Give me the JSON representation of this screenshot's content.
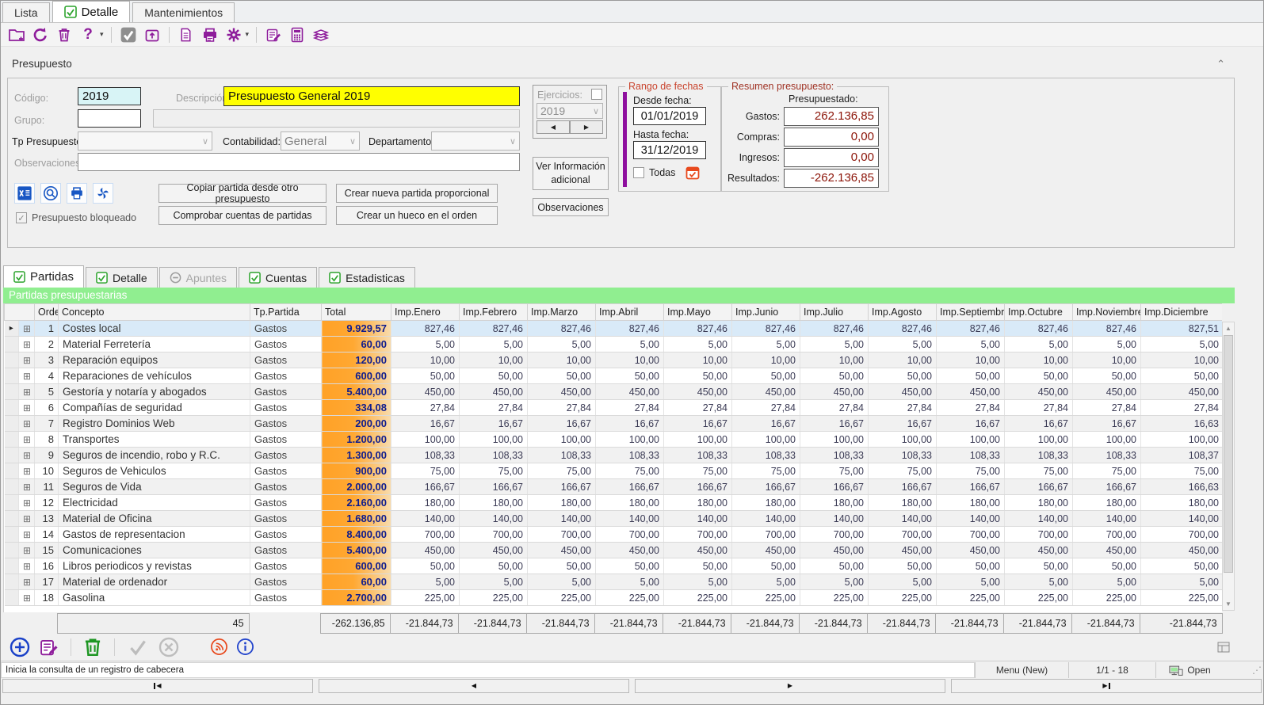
{
  "main_tabs": {
    "lista": "Lista",
    "detalle": "Detalle",
    "mantenimientos": "Mantenimientos"
  },
  "top_toolbar_icons": [
    "new-record-icon",
    "undo-icon",
    "delete-icon",
    "help-icon",
    "help-dropdown-icon",
    "confirm-checkbox-icon",
    "open-window-icon",
    "document-icon",
    "print-icon",
    "settings-gear-icon",
    "settings-dropdown-icon",
    "edit-notes-icon",
    "calculator-icon",
    "books-icon"
  ],
  "form": {
    "section_title": "Presupuesto",
    "codigo": {
      "label": "Código:",
      "value": "2019"
    },
    "descripcion": {
      "label": "Descripción:",
      "value": "Presupuesto General 2019"
    },
    "grupo": {
      "label": "Grupo:",
      "value": ""
    },
    "tp_presupuesto": {
      "label": "Tp Presupuesto:",
      "value": ""
    },
    "contabilidad": {
      "label": "Contabilidad:",
      "value": "General"
    },
    "departamento": {
      "label": "Departamento:",
      "value": ""
    },
    "observaciones": {
      "label": "Observaciones:",
      "value": ""
    },
    "mini_icons": [
      "excel-icon",
      "preview-icon",
      "print-icon",
      "refresh-icon"
    ],
    "bloqueado_label": "Presupuesto bloqueado",
    "action_buttons": [
      "Copiar partida desde otro presupuesto",
      "Crear nueva partida proporcional",
      "Comprobar cuentas de partidas",
      "Crear un hueco en el orden"
    ]
  },
  "ejercicios": {
    "label": "Ejercicios:",
    "value": "2019"
  },
  "side_buttons": {
    "ver_info": "Ver Información adicional",
    "observaciones": "Observaciones"
  },
  "rango_fechas": {
    "title": "Rango de fechas",
    "desde_label": "Desde fecha:",
    "desde_value": "01/01/2019",
    "hasta_label": "Hasta fecha:",
    "hasta_value": "31/12/2019",
    "todas_label": "Todas",
    "calendar_icon": "calendar-icon"
  },
  "resumen": {
    "title": "Resumen presupuesto:",
    "header": "Presupuestado:",
    "rows": [
      {
        "label": "Gastos:",
        "value": "262.136,85"
      },
      {
        "label": "Compras:",
        "value": "0,00"
      },
      {
        "label": "Ingresos:",
        "value": "0,00"
      },
      {
        "label": "Resultados:",
        "value": "-262.136,85"
      }
    ]
  },
  "subtabs": [
    {
      "label": "Partidas",
      "state": "active"
    },
    {
      "label": "Detalle",
      "state": "normal"
    },
    {
      "label": "Apuntes",
      "state": "disabled"
    },
    {
      "label": "Cuentas",
      "state": "normal"
    },
    {
      "label": "Estadisticas",
      "state": "normal"
    }
  ],
  "grid": {
    "title": "Partidas presupuestarias",
    "columns": [
      "Orden",
      "Concepto",
      "Tp.Partida",
      "Total",
      "Imp.Enero",
      "Imp.Febrero",
      "Imp.Marzo",
      "Imp.Abril",
      "Imp.Mayo",
      "Imp.Junio",
      "Imp.Julio",
      "Imp.Agosto",
      "Imp.Septiembre",
      "Imp.Octubre",
      "Imp.Noviembre",
      "Imp.Diciembre"
    ],
    "rows": [
      {
        "orden": "1",
        "concepto": "Costes local",
        "tp": "Gastos",
        "total": "9.929,57",
        "monthly": "827,46",
        "diciembre": "827,51",
        "selected": true
      },
      {
        "orden": "2",
        "concepto": "Material Ferretería",
        "tp": "Gastos",
        "total": "60,00",
        "monthly": "5,00",
        "diciembre": "5,00"
      },
      {
        "orden": "3",
        "concepto": "Reparación equipos",
        "tp": "Gastos",
        "total": "120,00",
        "monthly": "10,00",
        "diciembre": "10,00"
      },
      {
        "orden": "4",
        "concepto": "Reparaciones de vehículos",
        "tp": "Gastos",
        "total": "600,00",
        "monthly": "50,00",
        "diciembre": "50,00"
      },
      {
        "orden": "5",
        "concepto": "Gestoría y notaría y abogados",
        "tp": "Gastos",
        "total": "5.400,00",
        "monthly": "450,00",
        "diciembre": "450,00"
      },
      {
        "orden": "6",
        "concepto": "Compañías de seguridad",
        "tp": "Gastos",
        "total": "334,08",
        "monthly": "27,84",
        "diciembre": "27,84"
      },
      {
        "orden": "7",
        "concepto": "Registro Dominios Web",
        "tp": "Gastos",
        "total": "200,00",
        "monthly": "16,67",
        "diciembre": "16,63"
      },
      {
        "orden": "8",
        "concepto": "Transportes",
        "tp": "Gastos",
        "total": "1.200,00",
        "monthly": "100,00",
        "diciembre": "100,00"
      },
      {
        "orden": "9",
        "concepto": "Seguros de incendio, robo y R.C.",
        "tp": "Gastos",
        "total": "1.300,00",
        "monthly": "108,33",
        "diciembre": "108,37"
      },
      {
        "orden": "10",
        "concepto": "Seguros de Vehiculos",
        "tp": "Gastos",
        "total": "900,00",
        "monthly": "75,00",
        "diciembre": "75,00"
      },
      {
        "orden": "11",
        "concepto": "Seguros de Vida",
        "tp": "Gastos",
        "total": "2.000,00",
        "monthly": "166,67",
        "diciembre": "166,63"
      },
      {
        "orden": "12",
        "concepto": "Electricidad",
        "tp": "Gastos",
        "total": "2.160,00",
        "monthly": "180,00",
        "diciembre": "180,00"
      },
      {
        "orden": "13",
        "concepto": "Material de Oficina",
        "tp": "Gastos",
        "total": "1.680,00",
        "monthly": "140,00",
        "diciembre": "140,00"
      },
      {
        "orden": "14",
        "concepto": "Gastos de representacion",
        "tp": "Gastos",
        "total": "8.400,00",
        "monthly": "700,00",
        "diciembre": "700,00"
      },
      {
        "orden": "15",
        "concepto": "Comunicaciones",
        "tp": "Gastos",
        "total": "5.400,00",
        "monthly": "450,00",
        "diciembre": "450,00"
      },
      {
        "orden": "16",
        "concepto": "Libros periodicos y revistas",
        "tp": "Gastos",
        "total": "600,00",
        "monthly": "50,00",
        "diciembre": "50,00"
      },
      {
        "orden": "17",
        "concepto": "Material de ordenador",
        "tp": "Gastos",
        "total": "60,00",
        "monthly": "5,00",
        "diciembre": "5,00"
      },
      {
        "orden": "18",
        "concepto": "Gasolina",
        "tp": "Gastos",
        "total": "2.700,00",
        "monthly": "225,00",
        "diciembre": "225,00"
      }
    ],
    "footer": {
      "count": "45",
      "total": "-262.136,85",
      "monthly": "-21.844,73"
    }
  },
  "bottom_toolbar_icons": [
    "add-record-icon",
    "edit-record-icon",
    "delete-record-icon",
    "confirm-icon",
    "cancel-icon",
    "rss-icon",
    "info-icon"
  ],
  "status_bar": {
    "message": "Inicia la consulta de un registro de cabecera",
    "menu": "Menu (New)",
    "record_info": "1/1 - 18",
    "connection": "Open"
  },
  "pager_icons": [
    "first-record-icon",
    "previous-record-icon",
    "next-record-icon",
    "last-record-icon"
  ]
}
